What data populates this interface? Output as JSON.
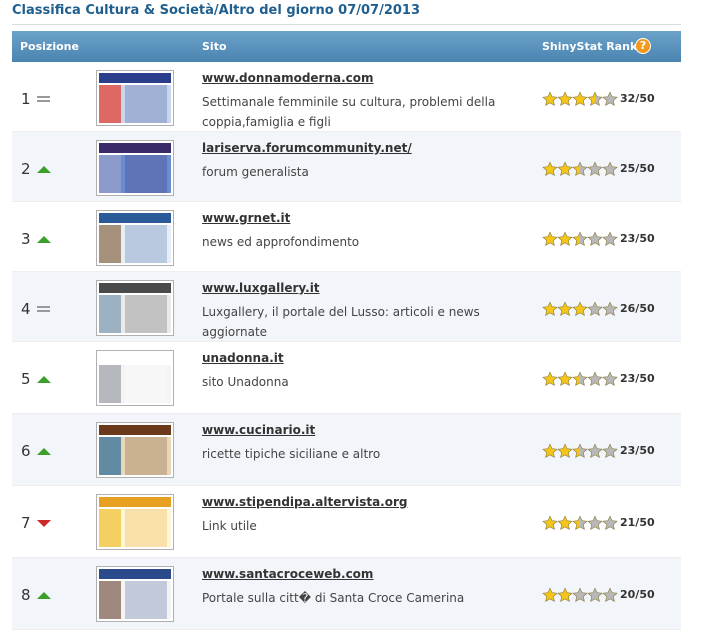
{
  "page_title": "Classifica Cultura & Società/Altro del giorno 07/07/2013",
  "header": {
    "position_label": "Posizione",
    "site_label": "Sito",
    "rank_label": "ShinyStat Rank",
    "help_icon": "question-icon",
    "help_glyph": "?"
  },
  "colors": {
    "title": "#1f5f8f",
    "header_bg": "#4a84b1",
    "help": "#f29a20",
    "trend_up": "#3aa02a",
    "trend_down": "#cc2a2a",
    "trend_equal": "#999999",
    "star_full": "#f5c518",
    "star_empty": "#b8b8b8"
  },
  "rows": [
    {
      "position": "1",
      "trend": "equal",
      "site": "www.donnamoderna.com",
      "description": "Settimanale femminile su cultura, problemi della coppia,famiglia e figli",
      "stars": 3.5,
      "score": "32/50",
      "thumb": [
        "#2a3e8c",
        "#c8d6ee",
        "#e63a2a"
      ]
    },
    {
      "position": "2",
      "trend": "up",
      "site": "lariserva.forumcommunity.net/",
      "description": "forum generalista",
      "stars": 2.5,
      "score": "25/50",
      "thumb": [
        "#3a2a6a",
        "#6a8cd0",
        "#9aa0c8"
      ]
    },
    {
      "position": "3",
      "trend": "up",
      "site": "www.grnet.it",
      "description": "news ed approfondimento",
      "stars": 2.5,
      "score": "23/50",
      "thumb": [
        "#2a5a9a",
        "#e8eef6",
        "#8a6a4a"
      ]
    },
    {
      "position": "4",
      "trend": "equal",
      "site": "www.luxgallery.it",
      "description": "Luxgallery, il portale del Lusso: articoli e news aggiornate",
      "stars": 3,
      "score": "26/50",
      "thumb": [
        "#4a4a4a",
        "#eaeaea",
        "#7a9ab0"
      ]
    },
    {
      "position": "5",
      "trend": "up",
      "site": "unadonna.it",
      "description": "sito Unadonna",
      "stars": 2.5,
      "score": "23/50",
      "thumb": [
        "#ffffff",
        "#f4f4f4",
        "#9aa0a6"
      ]
    },
    {
      "position": "6",
      "trend": "up",
      "site": "www.cucinario.it",
      "description": "ricette tipiche siciliane e altro",
      "stars": 2.5,
      "score": "23/50",
      "thumb": [
        "#6a3a1a",
        "#e8d8b8",
        "#2a6a9a"
      ]
    },
    {
      "position": "7",
      "trend": "down",
      "site": "www.stipendipa.altervista.org",
      "description": "Link utile",
      "stars": 2.5,
      "score": "21/50",
      "thumb": [
        "#e8a020",
        "#fff6d8",
        "#f0c030"
      ]
    },
    {
      "position": "8",
      "trend": "up",
      "site": "www.santacroceweb.com",
      "description": "Portale sulla citt� di Santa Croce Camerina",
      "stars": 2,
      "score": "20/50",
      "thumb": [
        "#2a4a8a",
        "#f4f4f4",
        "#7a5a4a"
      ]
    }
  ]
}
